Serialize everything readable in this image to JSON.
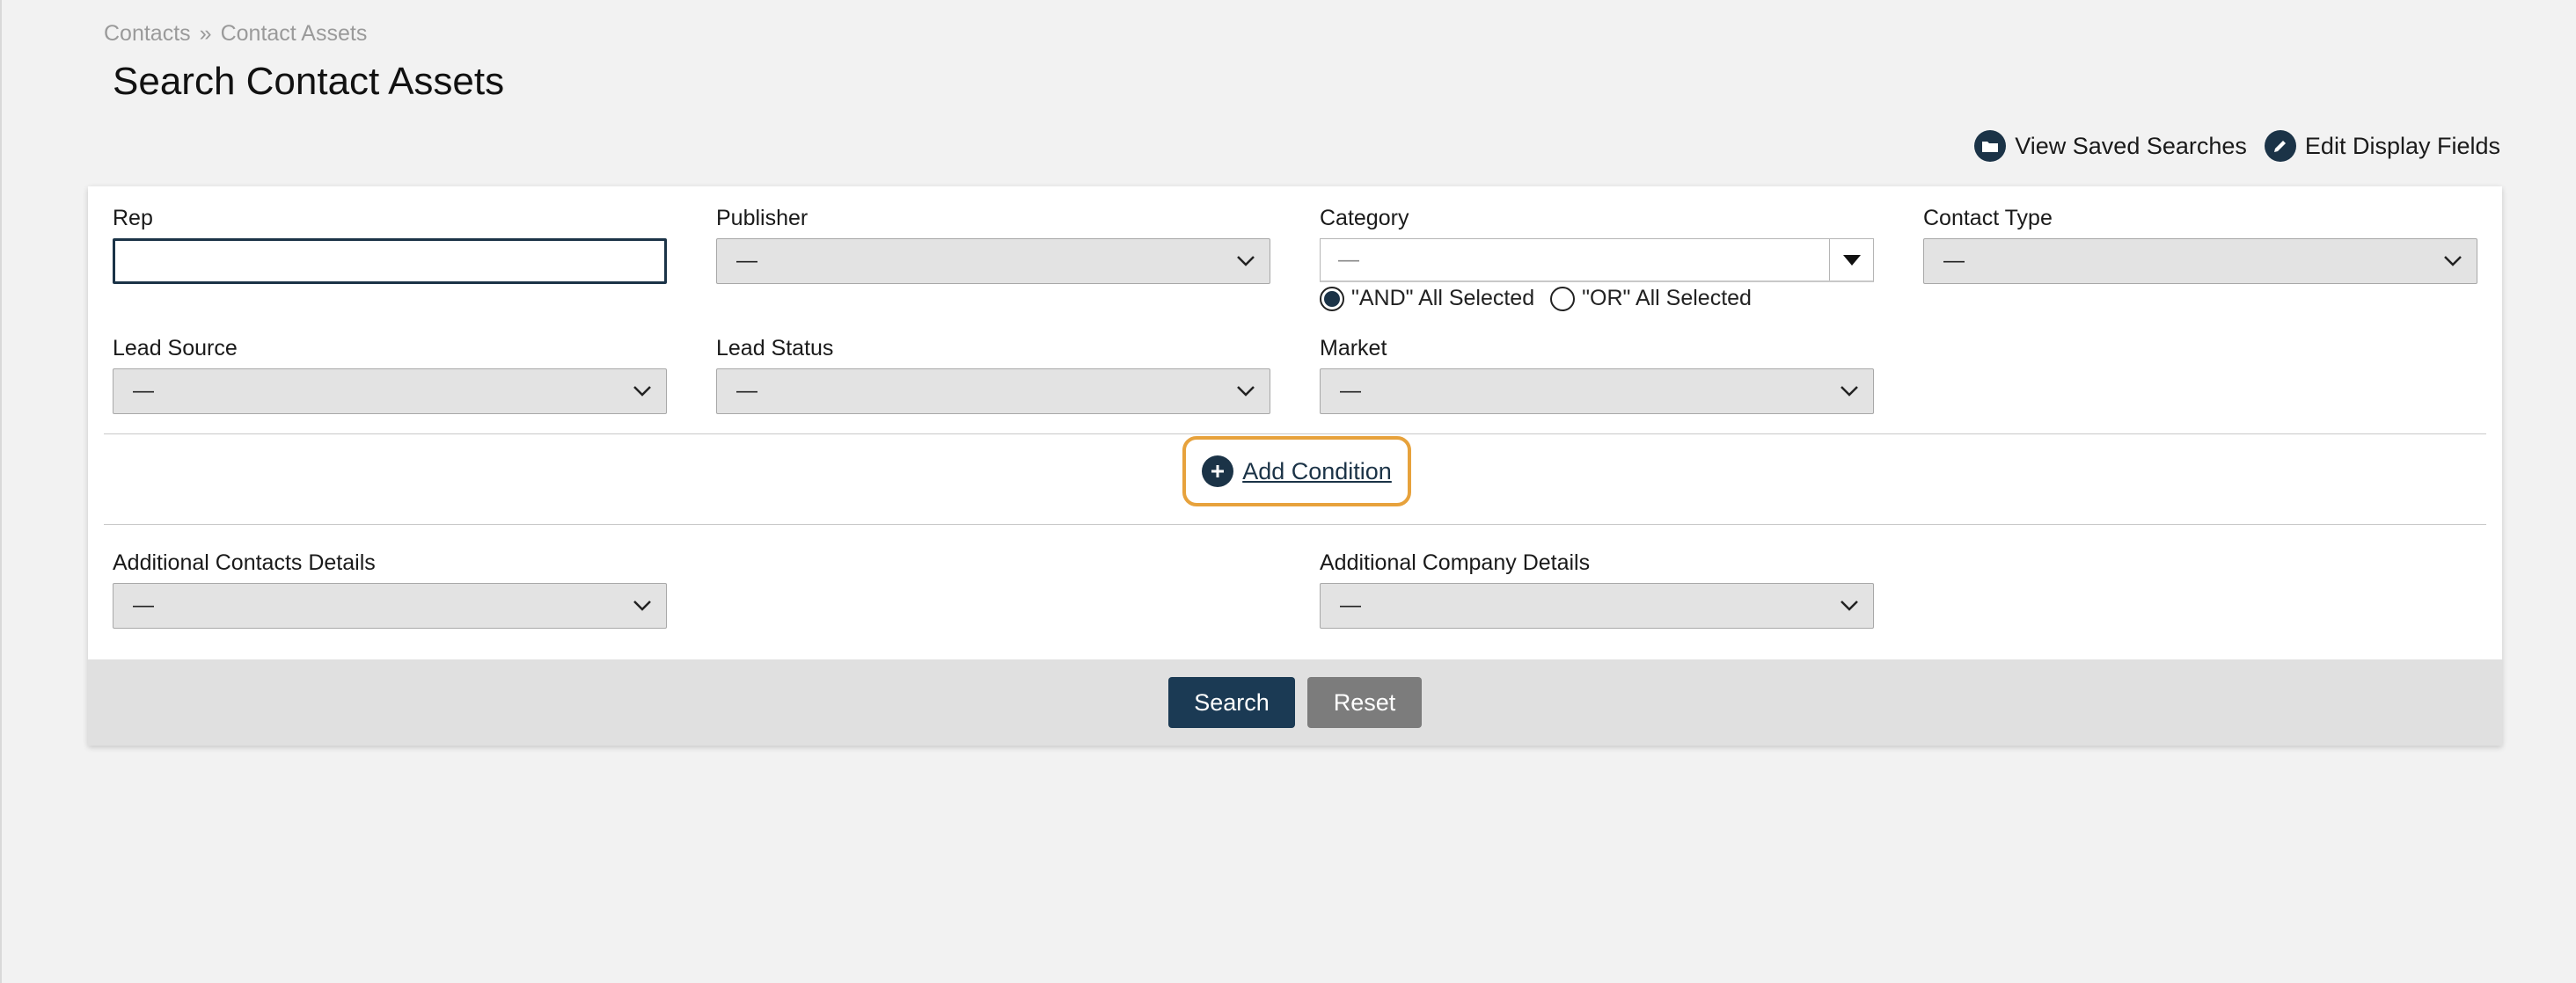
{
  "breadcrumb": {
    "items": [
      "Contacts",
      "Contact Assets"
    ],
    "separator": "»"
  },
  "page_title": "Search Contact Assets",
  "actions": {
    "view_saved": "View Saved Searches",
    "edit_fields": "Edit Display Fields"
  },
  "fields": {
    "rep": {
      "label": "Rep",
      "value": ""
    },
    "publisher": {
      "label": "Publisher",
      "value": "—"
    },
    "category": {
      "label": "Category",
      "value": "—",
      "radio_and": "\"AND\" All Selected",
      "radio_or": "\"OR\" All Selected",
      "selected_radio": "and"
    },
    "contact_type": {
      "label": "Contact Type",
      "value": "—"
    },
    "lead_source": {
      "label": "Lead Source",
      "value": "—"
    },
    "lead_status": {
      "label": "Lead Status",
      "value": "—"
    },
    "market": {
      "label": "Market",
      "value": "—"
    },
    "additional_contacts": {
      "label": "Additional Contacts Details",
      "value": "—"
    },
    "additional_company": {
      "label": "Additional Company Details",
      "value": "—"
    }
  },
  "add_condition": "Add Condition",
  "buttons": {
    "search": "Search",
    "reset": "Reset"
  },
  "colors": {
    "primary": "#1b3347",
    "highlight": "#e7a23c",
    "reset": "#7c7c7c"
  }
}
